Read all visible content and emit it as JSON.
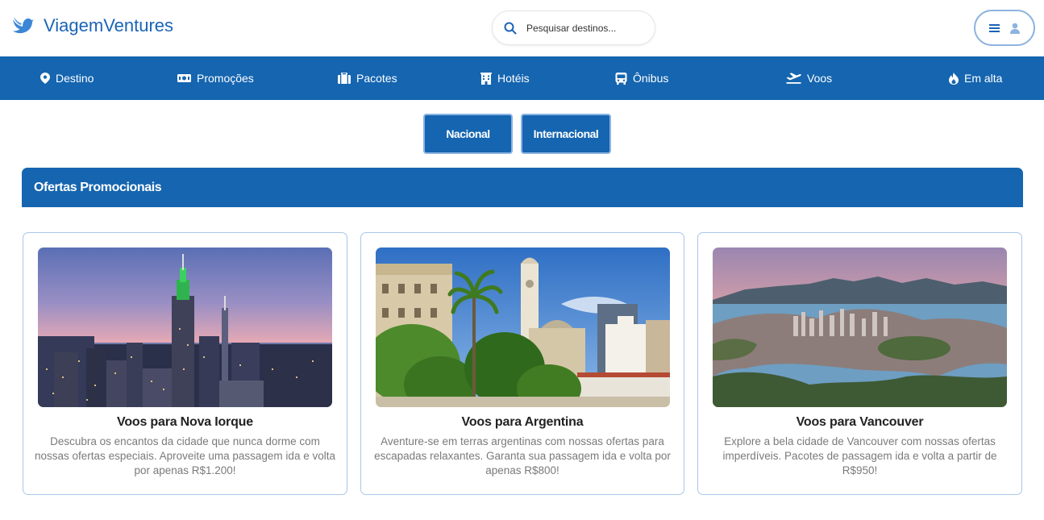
{
  "brand": {
    "name": "ViagemVentures",
    "icon": "bird-icon",
    "color": "#1a64b6"
  },
  "search": {
    "placeholder": "Pesquisar destinos..."
  },
  "user_menu": {
    "icons": [
      "menu-icon",
      "user-icon"
    ]
  },
  "nav": {
    "items": [
      {
        "label": "Destino",
        "icon": "map-pin-icon"
      },
      {
        "label": "Promoções",
        "icon": "ticket-icon"
      },
      {
        "label": "Pacotes",
        "icon": "suitcase-icon"
      },
      {
        "label": "Hotéis",
        "icon": "hotel-icon"
      },
      {
        "label": "Ônibus",
        "icon": "bus-icon"
      },
      {
        "label": "Voos",
        "icon": "plane-departure-icon"
      },
      {
        "label": "Em alta",
        "icon": "fire-icon"
      }
    ]
  },
  "toggle": {
    "national": "Nacional",
    "international": "Internacional"
  },
  "section": {
    "title": "Ofertas Promocionais"
  },
  "cards": [
    {
      "title": "Voos para Nova Iorque",
      "description": "Descubra os encantos da cidade que nunca dorme com nossas ofertas especiais. Aproveite uma passagem ida e volta por apenas R$1.200!"
    },
    {
      "title": "Voos para Argentina",
      "description": "Aventure-se em terras argentinas com nossas ofertas para escapadas relaxantes. Garanta sua passagem ida e volta por apenas R$800!"
    },
    {
      "title": "Voos para Vancouver",
      "description": "Explore a bela cidade de Vancouver com nossas ofertas imperdíveis. Pacotes de passagem ida e volta a partir de R$950!"
    }
  ],
  "colors": {
    "primary": "#1565b0",
    "card_border": "#a8c6ea",
    "text_muted": "#7a7a7a"
  }
}
